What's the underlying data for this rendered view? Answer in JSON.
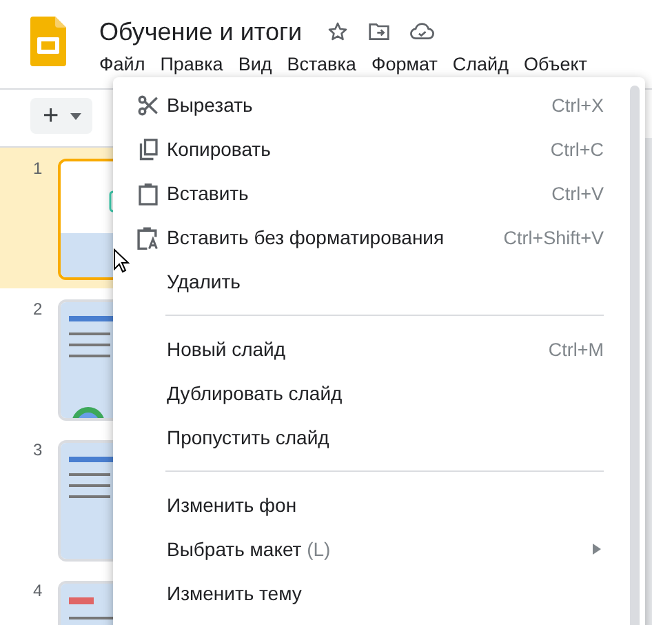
{
  "document": {
    "title": "Обучение и итоги"
  },
  "menu_bar": [
    "Файл",
    "Правка",
    "Вид",
    "Вставка",
    "Формат",
    "Слайд",
    "Объект"
  ],
  "toolbar": {
    "add_button": "+"
  },
  "slides": [
    {
      "number": "1",
      "selected": true,
      "kind": "title"
    },
    {
      "number": "2",
      "selected": false,
      "kind": "list"
    },
    {
      "number": "3",
      "selected": false,
      "kind": "list"
    },
    {
      "number": "4",
      "selected": false,
      "kind": "summary"
    }
  ],
  "context_menu": [
    {
      "kind": "cut",
      "label": "Вырезать",
      "shortcut": "Ctrl+X"
    },
    {
      "kind": "copy",
      "label": "Копировать",
      "shortcut": "Ctrl+C"
    },
    {
      "kind": "paste",
      "label": "Вставить",
      "shortcut": "Ctrl+V"
    },
    {
      "kind": "paste_plain",
      "label": "Вставить без форматирования",
      "shortcut": "Ctrl+Shift+V"
    },
    {
      "kind": "item",
      "label": "Удалить"
    },
    {
      "kind": "separator"
    },
    {
      "kind": "item",
      "label": "Новый слайд",
      "shortcut": "Ctrl+M"
    },
    {
      "kind": "item",
      "label": "Дублировать слайд"
    },
    {
      "kind": "item",
      "label": "Пропустить слайд"
    },
    {
      "kind": "separator"
    },
    {
      "kind": "item",
      "label": "Изменить фон"
    },
    {
      "kind": "item",
      "label": "Выбрать макет",
      "hint": "(L)",
      "submenu": true
    },
    {
      "kind": "item",
      "label": "Изменить тему"
    }
  ]
}
